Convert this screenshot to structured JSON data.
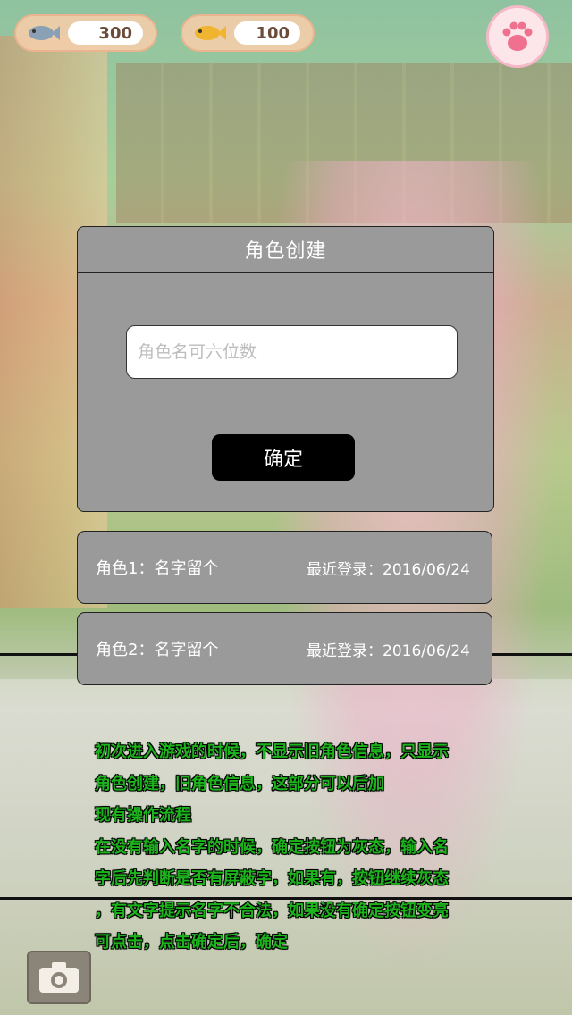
{
  "hud": {
    "currency1_value": "300",
    "currency2_value": "100",
    "currency1_icon": "fish-icon",
    "currency2_icon": "gold-fish-icon",
    "menu_icon": "paw-icon"
  },
  "dialog": {
    "title": "角色创建",
    "name_placeholder": "角色名可六位数",
    "confirm_label": "确定"
  },
  "characters": [
    {
      "label": "角色1：名字留个",
      "last_login_label": "最近登录：",
      "last_login_date": "2016/06/24"
    },
    {
      "label": "角色2：名字留个",
      "last_login_label": "最近登录：",
      "last_login_date": "2016/06/24"
    }
  ],
  "notes": [
    "初次进入游戏的时候，不显示旧角色信息，只显示",
    "角色创建，旧角色信息，这部分可以后加",
    "现有操作流程",
    "在没有输入名字的时候，确定按钮为灰态，输入名",
    "字后先判断是否有屏蔽字，如果有，按钮继续灰态",
    "，有文字提示名字不合法，如果没有确定按钮变亮",
    "可点击，点击确定后，确定"
  ],
  "colors": {
    "panel": "#9a9a9a",
    "confirm_button": "#000000",
    "notes_text": "#1db31d"
  }
}
